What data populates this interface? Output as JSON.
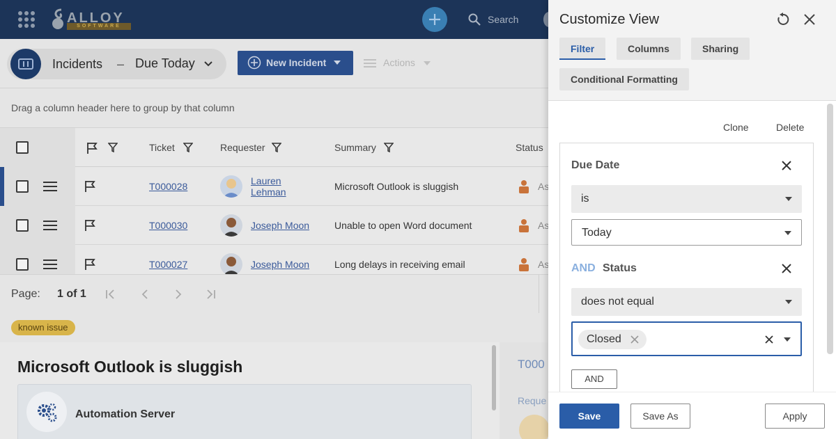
{
  "topbar": {
    "logo_text": "ALLOY",
    "logo_subtext": "SOFTWARE",
    "search_label": "Search"
  },
  "header": {
    "module": "Incidents",
    "separator": "–",
    "view_name": "Due Today",
    "new_button": "New Incident",
    "actions_label": "Actions"
  },
  "groupbar": {
    "hint": "Drag a column header here to group by that column"
  },
  "grid": {
    "columns": [
      "Ticket",
      "Requester",
      "Summary",
      "Status"
    ],
    "rows": [
      {
        "ticket": "T000028",
        "requester_line1": "Lauren",
        "requester_line2": "Lehman",
        "summary": "Microsoft Outlook is sluggish",
        "status": "As"
      },
      {
        "ticket": "T000030",
        "requester_line1": "Joseph Moon",
        "requester_line2": "",
        "summary": "Unable to open Word document",
        "status": "As"
      },
      {
        "ticket": "T000027",
        "requester_line1": "Joseph Moon",
        "requester_line2": "",
        "summary": "Long delays in receiving email",
        "status": "As"
      }
    ]
  },
  "pager": {
    "label": "Page:",
    "value": "1 of 1"
  },
  "tags": {
    "tag1": "known issue"
  },
  "detail": {
    "title": "Microsoft Outlook is sluggish",
    "card_title": "Automation Server",
    "right_id": "T000",
    "right_req": "Reque"
  },
  "panel": {
    "title": "Customize View",
    "tabs": [
      "Filter",
      "Columns",
      "Sharing",
      "Conditional Formatting"
    ],
    "active_tab": "Filter",
    "clone_label": "Clone",
    "delete_label": "Delete",
    "filters": [
      {
        "field": "Due Date",
        "operator": "is",
        "value": "Today"
      },
      {
        "connector": "AND",
        "field": "Status",
        "operator": "does not equal",
        "value_chip": "Closed"
      }
    ],
    "and_button": "AND",
    "save_label": "Save",
    "save_as_label": "Save As",
    "apply_label": "Apply"
  },
  "colors": {
    "topbar": "#1c3458",
    "accent": "#2a5da8",
    "tag": "#d8b44a"
  }
}
